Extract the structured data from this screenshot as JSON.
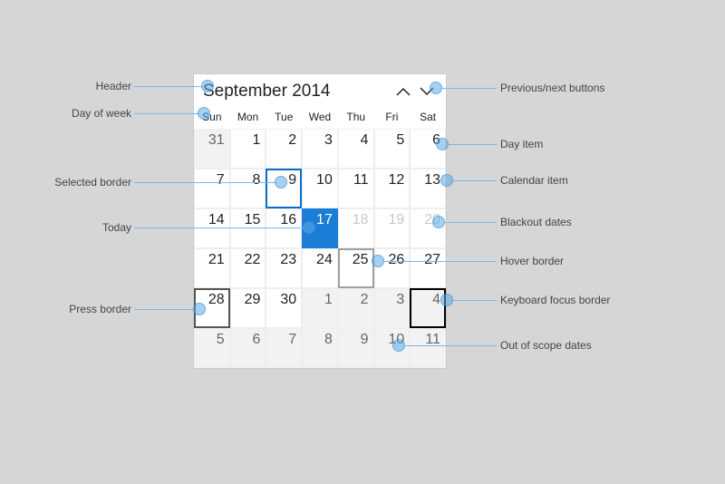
{
  "header": {
    "title": "September 2014"
  },
  "dow": [
    "Sun",
    "Mon",
    "Tue",
    "Wed",
    "Thu",
    "Fri",
    "Sat"
  ],
  "weeks": [
    [
      {
        "n": "31",
        "out": true
      },
      {
        "n": "1"
      },
      {
        "n": "2"
      },
      {
        "n": "3"
      },
      {
        "n": "4"
      },
      {
        "n": "5"
      },
      {
        "n": "6"
      }
    ],
    [
      {
        "n": "7"
      },
      {
        "n": "8"
      },
      {
        "n": "9",
        "selected": true
      },
      {
        "n": "10"
      },
      {
        "n": "11"
      },
      {
        "n": "12"
      },
      {
        "n": "13"
      }
    ],
    [
      {
        "n": "14"
      },
      {
        "n": "15"
      },
      {
        "n": "16"
      },
      {
        "n": "17",
        "today": true
      },
      {
        "n": "18",
        "blackout": true
      },
      {
        "n": "19",
        "blackout": true
      },
      {
        "n": "20",
        "blackout": true
      }
    ],
    [
      {
        "n": "21"
      },
      {
        "n": "22"
      },
      {
        "n": "23"
      },
      {
        "n": "24"
      },
      {
        "n": "25",
        "hover": true
      },
      {
        "n": "26"
      },
      {
        "n": "27"
      }
    ],
    [
      {
        "n": "28",
        "press": true
      },
      {
        "n": "29"
      },
      {
        "n": "30"
      },
      {
        "n": "1",
        "out": true
      },
      {
        "n": "2",
        "out": true
      },
      {
        "n": "3",
        "out": true
      },
      {
        "n": "4",
        "out": true,
        "focus": true
      }
    ],
    [
      {
        "n": "5",
        "out": true
      },
      {
        "n": "6",
        "out": true
      },
      {
        "n": "7",
        "out": true
      },
      {
        "n": "8",
        "out": true
      },
      {
        "n": "9",
        "out": true
      },
      {
        "n": "10",
        "out": true
      },
      {
        "n": "11",
        "out": true
      }
    ]
  ],
  "callouts": {
    "header": "Header",
    "dow": "Day of week",
    "selected": "Selected border",
    "today": "Today",
    "press": "Press border",
    "prevnext": "Previous/next buttons",
    "dayitem": "Day item",
    "calitem": "Calendar item",
    "blackout": "Blackout dates",
    "hover": "Hover border",
    "focus": "Keyboard focus border",
    "outofscope": "Out of scope dates"
  }
}
